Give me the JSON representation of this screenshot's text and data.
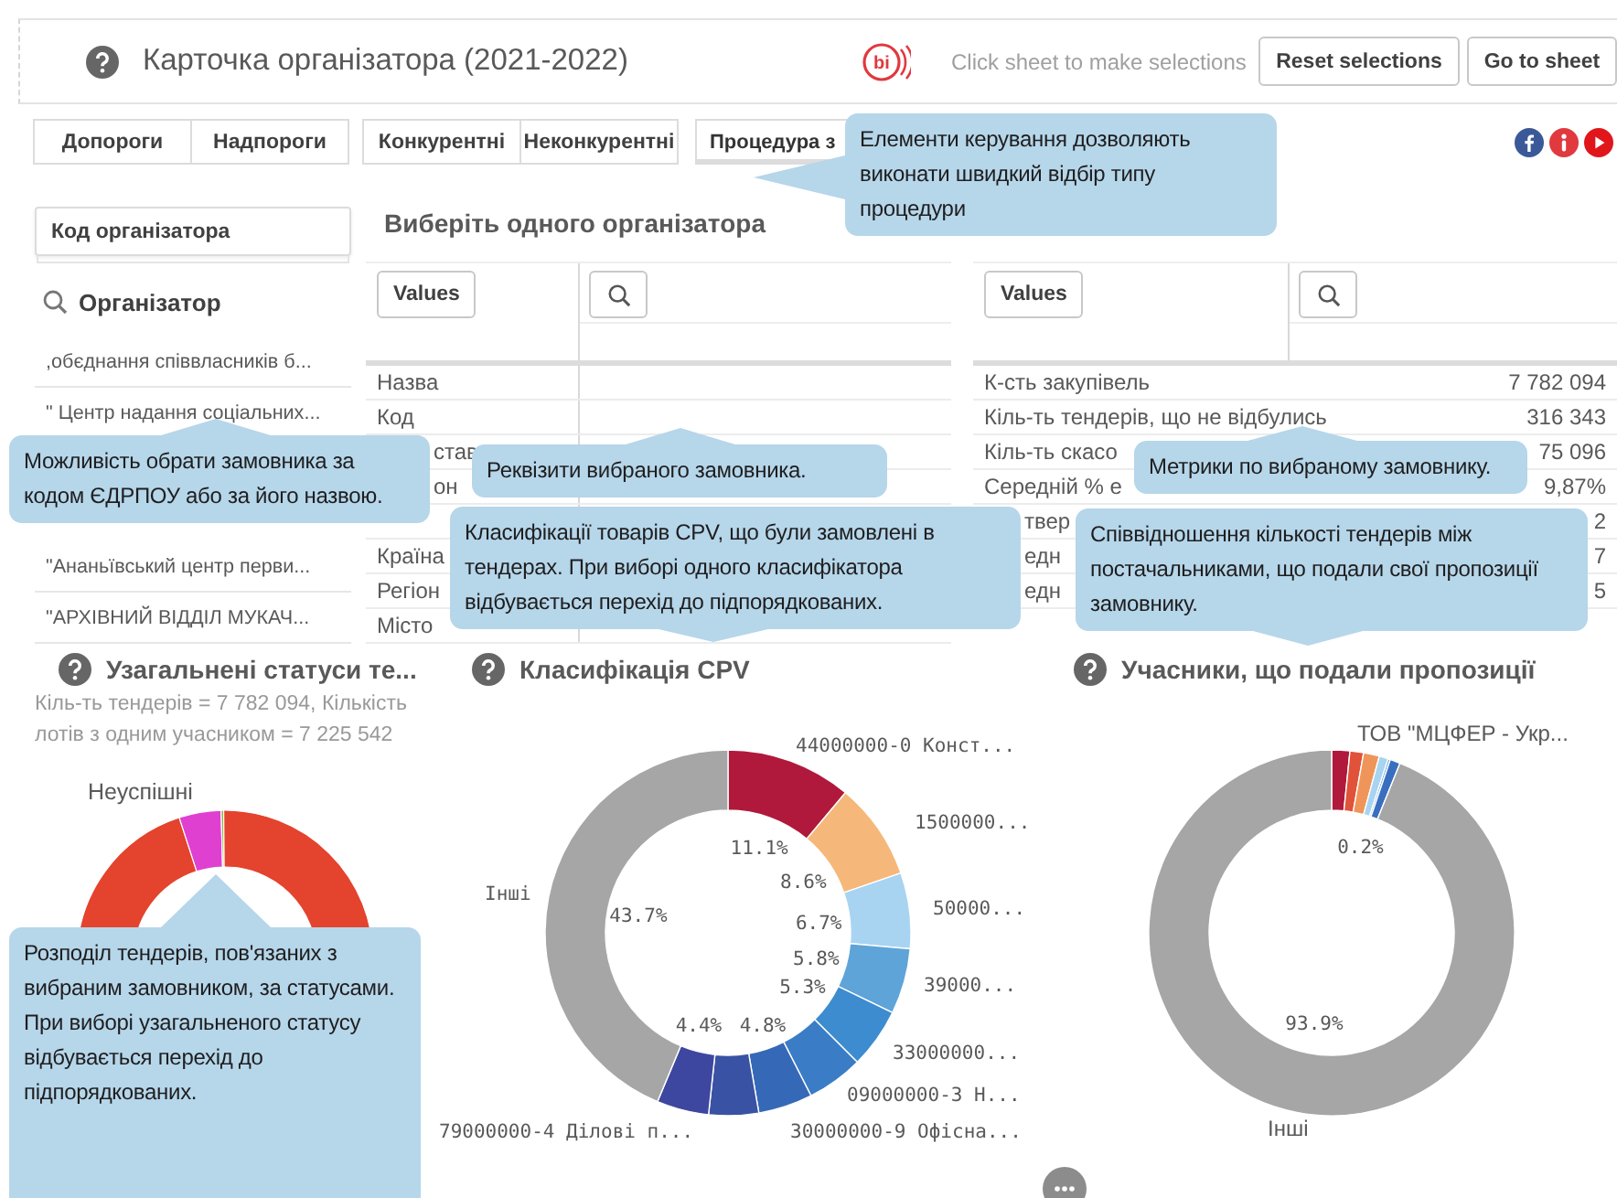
{
  "header": {
    "title": "Карточка організатора (2021-2022)",
    "logo_text": "bi",
    "hint": "Click sheet to make selections",
    "buttons": [
      "Reset selections",
      "Go to sheet"
    ]
  },
  "filters": {
    "groups": [
      [
        {
          "label": "Допороги",
          "selected": false
        },
        {
          "label": "Надпороги",
          "selected": false
        }
      ],
      [
        {
          "label": "Конкурентні",
          "selected": false
        },
        {
          "label": "Неконкурентні",
          "selected": false
        }
      ]
    ],
    "procedure": "Процедура з"
  },
  "organizer_filter": {
    "code_label": "Код організатора",
    "list_title": "Організатор",
    "items": [
      ",обєднання співвласників б...",
      "\" Центр надання соціальних...",
      "\"Ананьївський центр перви...",
      "\"АРХІВНИЙ ВІДДІЛ МУКАЧ..."
    ]
  },
  "section_title": "Виберіть одного організатора",
  "tables": [
    {
      "button": "Values",
      "rows": [
        {
          "label": "Назва",
          "kind": "full"
        },
        {
          "label": "Код",
          "kind": "full"
        },
        {
          "label": "став",
          "kind": "partial"
        },
        {
          "label": "он",
          "kind": "partial"
        },
        {
          "label": "Країна",
          "kind": "full"
        },
        {
          "label": "Регіон",
          "kind": "full"
        },
        {
          "label": "Місто",
          "kind": "full"
        }
      ]
    },
    {
      "button": "Values",
      "rows": [
        {
          "label": "К-сть закупівель",
          "value": "7 782 094",
          "kind": "full"
        },
        {
          "label": "Кіль-ть тендерів, що не відбулись",
          "value": "316 343",
          "kind": "full"
        },
        {
          "label": "Кіль-ть скасо",
          "value": "75 096",
          "kind": "full"
        },
        {
          "label": "Середній % е",
          "value": "9,87%",
          "kind": "full"
        },
        {
          "label": "твер",
          "value": "2",
          "kind": "partial"
        },
        {
          "label": "едн",
          "value": "7",
          "kind": "partial"
        },
        {
          "label": "едн",
          "value": "5",
          "kind": "partial"
        }
      ]
    }
  ],
  "charts": [
    {
      "title": "Узагальнені статуси те...",
      "subtitle": "Кіль-ть тендерів = 7 782 094, Кількість лотів з одним учасником = 7 225 542",
      "label": "Неуспішні"
    },
    {
      "title": "Класифікація CPV",
      "chart_data": {
        "type": "donut",
        "categories": [
          "44000000-0 Конст...",
          "1500000...",
          "50000...",
          "39000...",
          "33000000...",
          "09000000-3 Н...",
          "30000000-9 Офісна...",
          "79000000-4 Ділові п...",
          null,
          "Інші"
        ],
        "colors": [
          "#b0193b",
          "#f5b87a",
          "#a8d4f2",
          "#5ea4d8",
          "#3d8ccf",
          "#3a7dc6",
          "#3569b8",
          "#3a52a3",
          "#3e47a0",
          "#a6a6a6"
        ],
        "series": [
          {
            "values": [
              11.1,
              8.6,
              6.7,
              5.8,
              5.3,
              5.0,
              4.8,
              4.4,
              4.6,
              43.7
            ]
          }
        ],
        "value_labels": [
          "11.1%",
          "8.6%",
          "6.7%",
          "5.8%",
          "5.3%",
          null,
          "4.8%",
          "4.4%",
          null,
          "43.7%"
        ]
      }
    },
    {
      "title": "Учасники, що подали пропозиції",
      "chart_data": {
        "type": "donut",
        "categories": [
          "ТОВ \"МЦФЕР - Укр...",
          null,
          null,
          null,
          null,
          null,
          "Інші"
        ],
        "colors": [
          "#b0193b",
          "#e0523a",
          "#f0955a",
          "#a8d4f2",
          "#5ea4d8",
          "#3a6fc0",
          "#a6a6a6"
        ],
        "series": [
          {
            "values": [
              1.6,
              1.2,
              1.4,
              0.8,
              0.2,
              0.9,
              93.9
            ]
          }
        ],
        "value_labels": [
          null,
          null,
          null,
          null,
          "0.2%",
          null,
          "93.9%"
        ]
      }
    }
  ],
  "tooltips": [
    "Елементи керування дозволяють виконати швидкий відбір типу процедури",
    "Можливість обрати замовника за кодом ЄДРПОУ або за його назвою.",
    "Реквізити вибраного замовника.",
    "Класифікації товарів CPV, що були замовлені в тендерах. При виборі одного класифікатора відбувається перехід до підпорядкованих.",
    "Метрики по вибраному замовнику.",
    "Співвідношення кількості тендерів між постачальниками, що подали свої пропозиції замовнику.",
    "Розподіл тендерів, пов'язаних з вибраним замовником, за статусами. При виборі узагальненого статусу відбувається перехід до підпорядкованих."
  ]
}
